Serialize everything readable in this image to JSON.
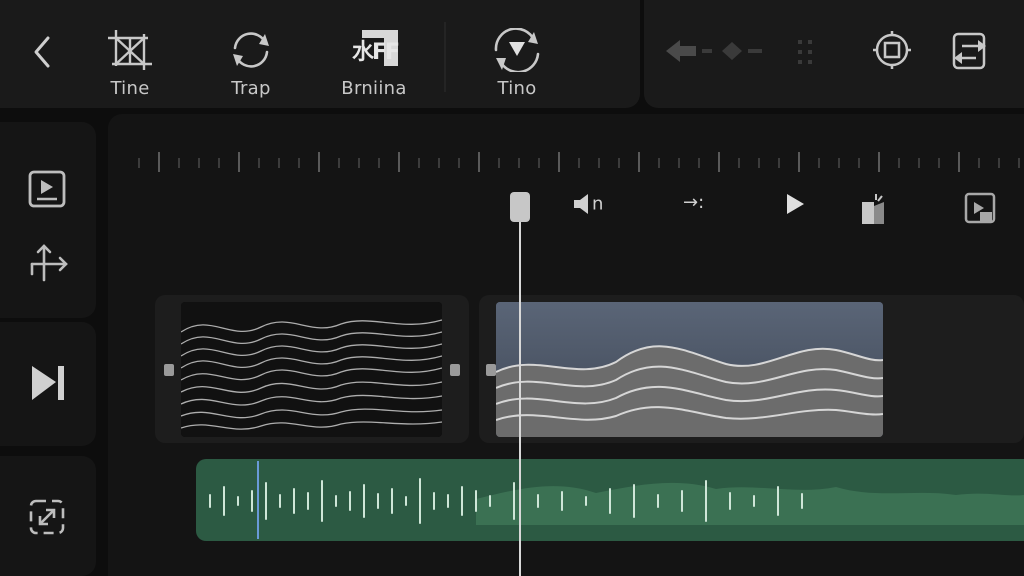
{
  "toolbar": {
    "back_label": "back",
    "tools": [
      {
        "label": "Tine",
        "icon": "crop-grid-icon"
      },
      {
        "label": "Trap",
        "icon": "rotate-arrows-icon"
      },
      {
        "label": "Brniina",
        "icon": "text-effect-icon"
      },
      {
        "label": "Tino",
        "icon": "transform-arrows-icon"
      }
    ],
    "right_icons": [
      "keyframe-arrows-icon",
      "frame-select-icon",
      "export-icon"
    ],
    "text_effect_glyph": "水FF"
  },
  "sidebar": {
    "icons": [
      "media-icon",
      "move-arrows-icon",
      "play-next-icon",
      "expand-icon"
    ]
  },
  "timeline": {
    "controls": [
      {
        "name": "volume-control",
        "text": "n"
      },
      {
        "name": "speed-control",
        "text": "→:"
      },
      {
        "name": "play-button",
        "text": ""
      },
      {
        "name": "effects-button",
        "text": ""
      },
      {
        "name": "preview-button",
        "text": ""
      }
    ],
    "clips": [
      {
        "name": "video-clip-1",
        "tone": "dark-waves"
      },
      {
        "name": "video-clip-2",
        "tone": "blue-waves"
      }
    ],
    "audio": {
      "name": "audio-track",
      "color": "#2c5a43"
    }
  },
  "colors": {
    "background": "#0d0d0d",
    "panel": "#1a1a1a",
    "audio_green": "#2c5a43",
    "clip_blue": "#4a5568",
    "playhead": "#d8d8d8"
  }
}
